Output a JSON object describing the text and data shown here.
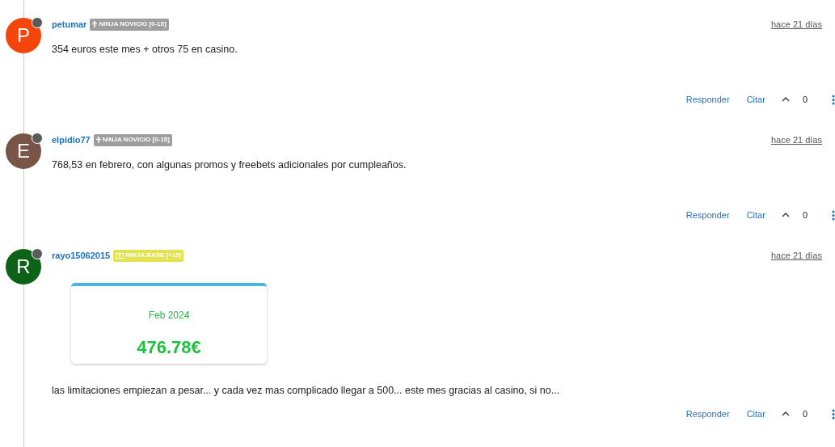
{
  "comments": [
    {
      "avatar_letter": "P",
      "color": "#f4460b",
      "username": "petumar",
      "badge": {
        "kind": "novice",
        "label": "NINJA NOVICIO [0-15]"
      },
      "time": "hace 21 días",
      "body": "354 euros este mes + otros 75 en casino.",
      "actions": {
        "reply": "Responder",
        "quote": "Citar",
        "votes": "0"
      }
    },
    {
      "avatar_letter": "E",
      "color": "#795548",
      "username": "elpidio77",
      "badge": {
        "kind": "novice",
        "label": "NINJA NOVICIO [0-15]"
      },
      "time": "hace 21 días",
      "body": "768,53 en febrero, con algunas promos y freebets adicionales por cumpleaños.",
      "actions": {
        "reply": "Responder",
        "quote": "Citar",
        "votes": "0"
      }
    },
    {
      "avatar_letter": "R",
      "color": "#0c6318",
      "username": "rayo15062015",
      "badge": {
        "kind": "base",
        "label": "NINJA BASE [+15]"
      },
      "time": "hace 21 días",
      "card": {
        "period": "Feb 2024",
        "amount": "476.78€"
      },
      "body": "las limitaciones empiezan a pesar... y cada vez mas complicado llegar a 500... este mes gracias al casino, si no...",
      "actions": {
        "reply": "Responder",
        "quote": "Citar",
        "votes": "0"
      }
    }
  ]
}
